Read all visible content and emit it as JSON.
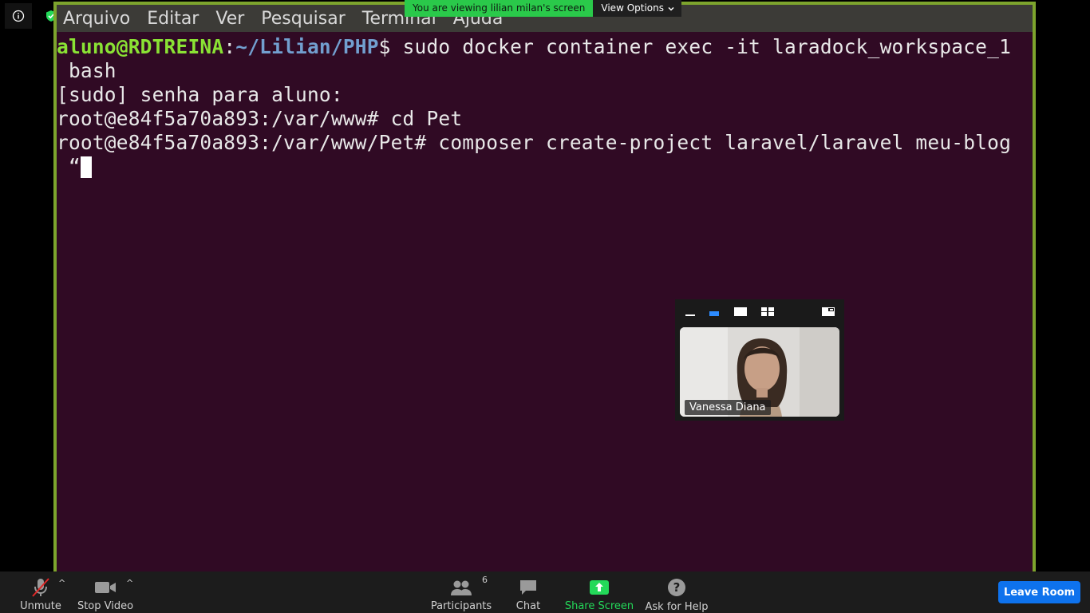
{
  "terminal": {
    "menu": [
      "Arquivo",
      "Editar",
      "Ver",
      "Pesquisar",
      "Terminal",
      "Ajuda"
    ],
    "lines": {
      "l1_user": "aluno@RDTREINA",
      "l1_sep": ":",
      "l1_path": "~/Lilian/PHP",
      "l1_cmd": "$ sudo docker container exec -it laradock_workspace_1",
      "l2": " bash",
      "l3": "[sudo] senha para aluno:",
      "l4": "root@e84f5a70a893:/var/www# cd Pet",
      "l5": "root@e84f5a70a893:/var/www/Pet# composer create-project laravel/laravel meu-blog",
      "l6": " “"
    }
  },
  "banner": {
    "message": "You are viewing lilian milan's screen",
    "view_options": "View Options"
  },
  "video": {
    "participant_name": "Vanessa Diana"
  },
  "toolbar": {
    "unmute": "Unmute",
    "stop_video": "Stop Video",
    "participants": "Participants",
    "participants_count": "6",
    "chat": "Chat",
    "share_screen": "Share Screen",
    "ask_help": "Ask for Help",
    "leave": "Leave Room"
  },
  "colors": {
    "terminal_bg": "#300a24",
    "prompt_user": "#8ae234",
    "prompt_path": "#729fcf",
    "share_accent": "#23d959",
    "leave_button": "#0e72ed"
  }
}
